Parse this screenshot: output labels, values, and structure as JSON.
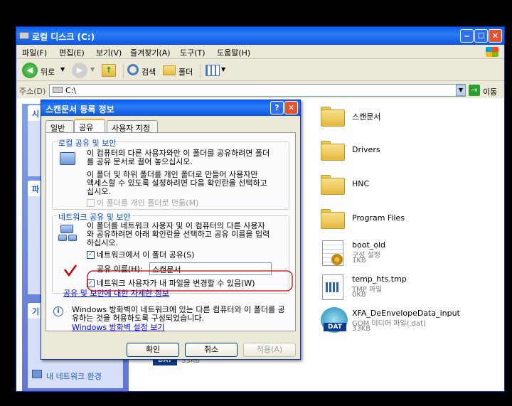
{
  "explorer": {
    "title": "로컬 디스크 (C:)",
    "menu": [
      "파일(F)",
      "편집(E)",
      "보기(V)",
      "즐겨찾기(A)",
      "도구(T)",
      "도움말(H)"
    ],
    "toolbar": {
      "back": "뒤로",
      "search": "검색",
      "folders": "폴더"
    },
    "address_label": "주소(D)",
    "address_value": "C:\\",
    "go_label": "이동",
    "left_pane": {
      "box1_head": "시",
      "box2_head": "파",
      "box3_head": "기",
      "network_link": "내 네트워크 환경"
    },
    "files": [
      {
        "name": "스캔문서",
        "kind": "folder"
      },
      {
        "name": "Drivers",
        "kind": "folder"
      },
      {
        "name": "HNC",
        "kind": "folder"
      },
      {
        "name": "Program Files",
        "kind": "folder"
      },
      {
        "name": "boot_old",
        "sub1": "구성 설정",
        "sub2": "1KB",
        "kind": "settings"
      },
      {
        "name": "temp_hts.tmp",
        "sub1": "TMP 파일",
        "sub2": "0KB",
        "kind": "tmp"
      },
      {
        "name": "XFA_DeEnvelopeData_input",
        "sub1": "GOM 미디어 파일(.dat)",
        "sub2": "33KB",
        "kind": "dat"
      }
    ],
    "dat_partial": {
      "label": "DAT",
      "size": "33KB"
    }
  },
  "dialog": {
    "title": "스캔문서 등록 정보",
    "tabs": [
      "일반",
      "공유",
      "사용자 지정"
    ],
    "local_group": {
      "title": "로컬 공유 및 보안",
      "text1": [
        "이 컴퓨터의 다른 사용자와만 이 폴더를 공유하려면 폴더",
        "를 공유 문서로 끌어 놓으십시오."
      ],
      "text2": [
        "이 폴더 및 하위 폴더를 개인 폴더로 만들어 사용자만",
        "액세스할 수 있도록 설정하려면 다음 확인란을 선택하고",
        "십시오."
      ],
      "private_checkbox": "이 폴더를 개인 폴더로 만듦(M)"
    },
    "network_group": {
      "title": "네트워크 공유 및 보안",
      "text": [
        "이 폴더를 네트워크 사용자 및 이 컴퓨터의 다른 사용자",
        "와 공유하려면 아래 확인란을 선택하고 공유 이름을 입력",
        "하십시오."
      ],
      "share_checkbox": "네트워크에서 이 폴더 공유(S)",
      "share_name_label": "공유 이름(H):",
      "share_name_value": "스캔문서",
      "allow_change_checkbox": "네트워크 사용자가 내 파일을 변경할 수 있음(W)",
      "more_info_link": "공유 및 보안에 대한 자세한 정보"
    },
    "firewall": {
      "text": [
        "Windows 방화벽이 네트워크에 있는 다른 컴퓨터와 이 폴더를 공",
        "유하는 것을 허용하도록 구성되었습니다."
      ],
      "link": "Windows 방화벽 설정 보기"
    },
    "buttons": {
      "ok": "확인",
      "cancel": "취소",
      "apply": "적용(A)"
    },
    "help_glyph": "?",
    "close_glyph": "✕"
  },
  "colors": {
    "xp_blue": "#0a5fe8",
    "annotation_red": "#cc0000",
    "group_title": "#0046d5"
  }
}
